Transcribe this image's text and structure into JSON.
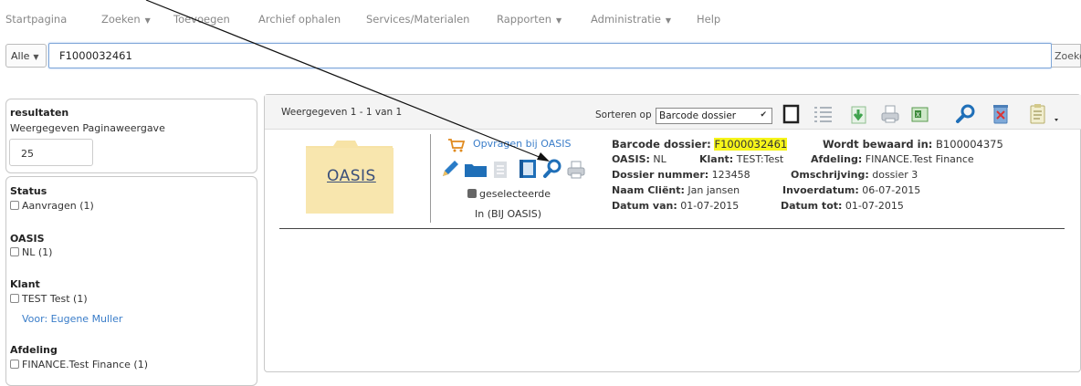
{
  "nav": {
    "items": [
      {
        "label": "Startpagina",
        "dropdown": false
      },
      {
        "label": "Zoeken",
        "dropdown": true
      },
      {
        "label": "Toevoegen",
        "dropdown": false
      },
      {
        "label": "Archief ophalen",
        "dropdown": false
      },
      {
        "label": "Services/Materialen",
        "dropdown": false
      },
      {
        "label": "Rapporten",
        "dropdown": true
      },
      {
        "label": "Administratie",
        "dropdown": true
      },
      {
        "label": "Help",
        "dropdown": false
      }
    ],
    "caret": "▼"
  },
  "search": {
    "scope": "Alle",
    "value": "F1000032461",
    "button": "Zoeken"
  },
  "sidebar": {
    "results_title": "resultaten",
    "page_view_label": "Weergegeven Paginaweergave",
    "per_page": "25",
    "facets": [
      {
        "title": "Status",
        "options": [
          {
            "label": "Aanvragen (1)"
          }
        ]
      },
      {
        "title": "OASIS",
        "options": [
          {
            "label": "NL (1)"
          }
        ]
      },
      {
        "title": "Klant",
        "options": [
          {
            "label": "TEST Test (1)"
          }
        ],
        "link": "Voor: Eugene Muller"
      },
      {
        "title": "Afdeling",
        "options": [
          {
            "label": "FINANCE.Test Finance (1)"
          }
        ]
      }
    ]
  },
  "results": {
    "showing": "Weergegeven 1 - 1 van 1",
    "sort_label": "Sorteren op",
    "sort_value": "Barcode dossier",
    "toolbar_icons": [
      "checkbox-square-icon",
      "list-icon",
      "download-icon",
      "printer-icon",
      "excel-icon",
      "search-icon",
      "delete-icon",
      "clipboard-icon"
    ],
    "item": {
      "logo_text": "OASIS",
      "request_link": "Opvragen bij OASIS",
      "selected_label": "geselecteerde",
      "location_status": "In (BIJ OASIS)",
      "barcode_label": "Barcode dossier:",
      "barcode_value": "F1000032461",
      "stored_label": "Wordt bewaard in:",
      "stored_value": "B100004375",
      "oasis_label": "OASIS:",
      "oasis_value": "NL",
      "klant_label": "Klant:",
      "klant_value": "TEST:Test",
      "afdeling_label": "Afdeling:",
      "afdeling_value": "FINANCE.Test Finance",
      "dossier_nr_label": "Dossier nummer:",
      "dossier_nr_value": "123458",
      "omschrijving_label": "Omschrijving:",
      "omschrijving_value": "dossier 3",
      "client_label": "Naam Cliënt:",
      "client_value": "Jan jansen",
      "invoer_label": "Invoerdatum:",
      "invoer_value": "06-07-2015",
      "datum_van_label": "Datum van:",
      "datum_van_value": "01-07-2015",
      "datum_tot_label": "Datum tot:",
      "datum_tot_value": "01-07-2015"
    }
  },
  "colors": {
    "link": "#3a7dc9",
    "highlight": "#f6f51a",
    "folder": "#f7e3a6",
    "toolbar_green": "#3fa34d",
    "toolbar_blue": "#2a7cc7"
  }
}
